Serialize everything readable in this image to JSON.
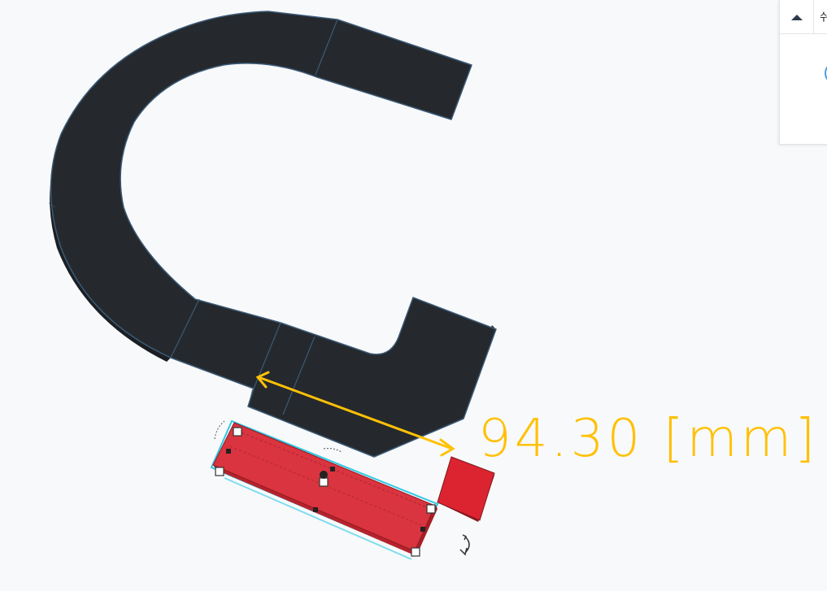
{
  "viewport": {
    "background": "#f8f9fa"
  },
  "measurement": {
    "label": "94.30 [mm]",
    "color": "#ffc107"
  },
  "shapes": {
    "main_shape_color": "#25292d",
    "main_shape_edge": "#3b5a78",
    "selected_box_color": "#d9343f",
    "selection_outline": "#2ec7e6",
    "small_box_color": "#dc2430"
  },
  "panel": {
    "title_char": "쉬",
    "collapse_icon": "chevron-up-icon",
    "accent": "#4a9de0"
  }
}
